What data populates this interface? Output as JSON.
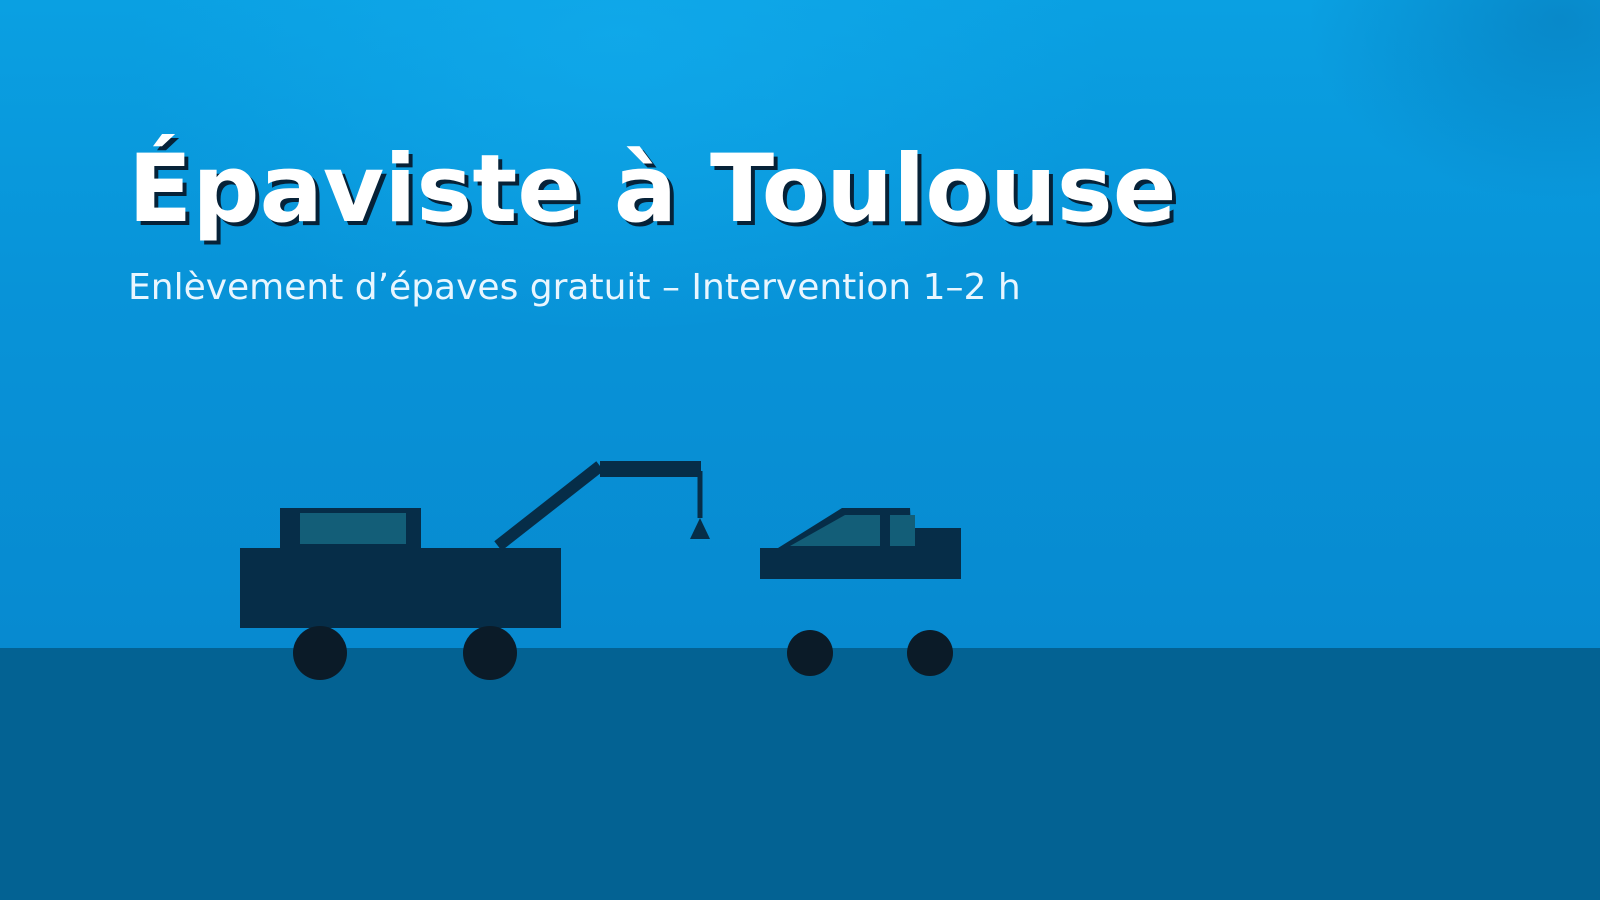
{
  "hero": {
    "title": "Épaviste à Toulouse",
    "subtitle": "Enlèvement d’épaves gratuit – Intervention 1–2 h"
  },
  "illustration": {
    "subjects": [
      "tow-truck",
      "wrecked-car"
    ],
    "colors": {
      "sky": "#0893d8",
      "ground": "#036293",
      "vehicle_body": "#062d48",
      "window": "#135e78",
      "wheel": "#0b1b28",
      "title_shadow": "#062238"
    }
  }
}
